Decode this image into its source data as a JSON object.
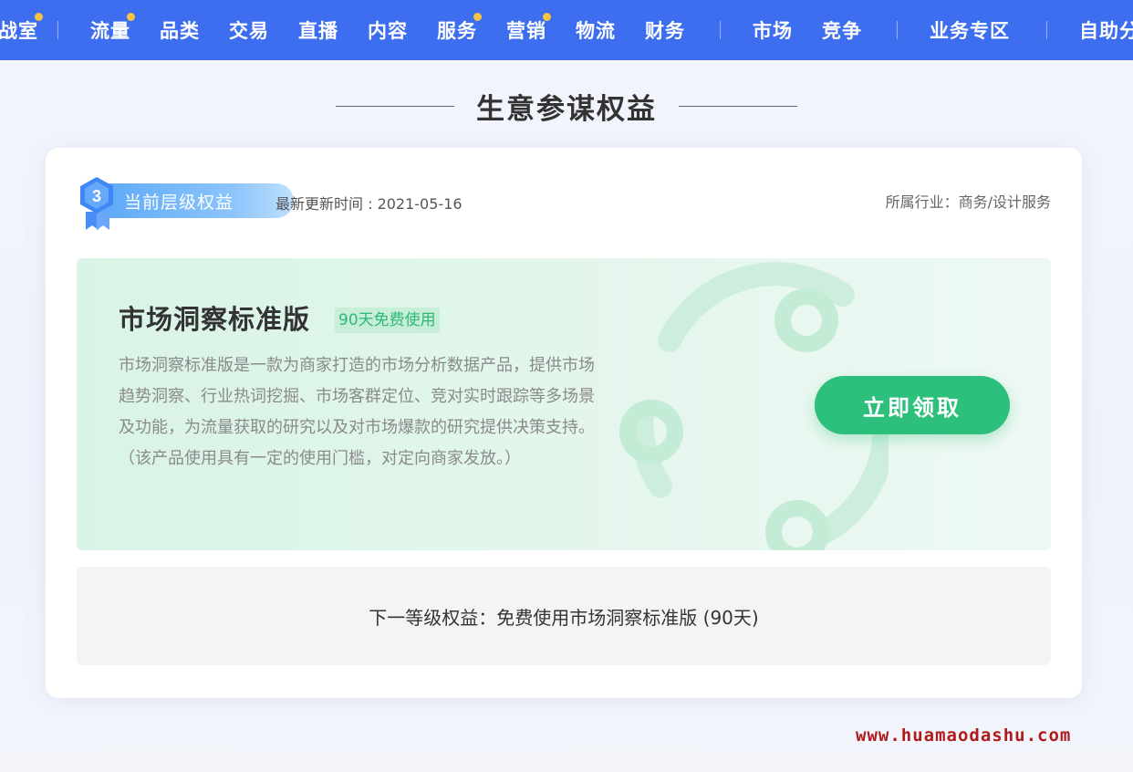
{
  "nav": {
    "items": [
      {
        "label": "作战室",
        "dot": true
      },
      {
        "label": "流量",
        "dot": true
      },
      {
        "label": "品类",
        "dot": false
      },
      {
        "label": "交易",
        "dot": false
      },
      {
        "label": "直播",
        "dot": false
      },
      {
        "label": "内容",
        "dot": false
      },
      {
        "label": "服务",
        "dot": true
      },
      {
        "label": "营销",
        "dot": true
      },
      {
        "label": "物流",
        "dot": false
      },
      {
        "label": "财务",
        "dot": false
      },
      {
        "label": "市场",
        "dot": false
      },
      {
        "label": "竞争",
        "dot": false
      },
      {
        "label": "业务专区",
        "dot": false
      },
      {
        "label": "自助分析",
        "dot": false
      }
    ],
    "dot_color": "#f5c542",
    "bg_color": "#3d6ef0"
  },
  "section": {
    "title": "生意参谋权益"
  },
  "card": {
    "level_number": "3",
    "level_label": "当前层级权益",
    "update_time": "最新更新时间 : 2021-05-16",
    "industry": "所属行业：商务/设计服务"
  },
  "product": {
    "name": "市场洞察标准版",
    "free_tag": "90天免费使用",
    "description": "市场洞察标准版是一款为商家打造的市场分析数据产品，提供市场趋势洞察、行业热词挖掘、市场客群定位、竞对实时跟踪等多场景及功能，为流量获取的研究以及对市场爆款的研究提供决策支持。（该产品使用具有一定的使用门槛，对定向商家发放。）",
    "claim_button": "立即领取",
    "accent_color": "#2dc07d"
  },
  "next_level": {
    "text": "下一等级权益：免费使用市场洞察标准版 (90天)"
  },
  "watermark": {
    "text": "www.huamaodashu.com"
  }
}
